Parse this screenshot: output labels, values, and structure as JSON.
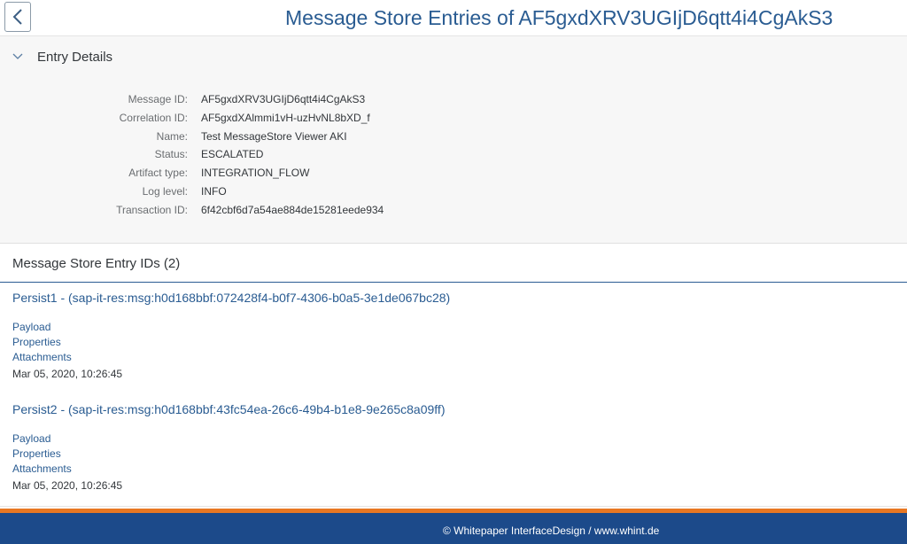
{
  "header": {
    "title": "Message Store Entries of AF5gxdXRV3UGIjD6qtt4i4CgAkS3",
    "back_icon": "chevron-left-icon"
  },
  "details": {
    "title": "Entry Details",
    "toggle_icon": "chevron-down-icon",
    "fields": [
      {
        "label": "Message ID:",
        "value": "AF5gxdXRV3UGIjD6qtt4i4CgAkS3"
      },
      {
        "label": "Correlation ID:",
        "value": "AF5gxdXAlmmi1vH-uzHvNL8bXD_f"
      },
      {
        "label": "Name:",
        "value": "Test MessageStore Viewer AKI"
      },
      {
        "label": "Status:",
        "value": "ESCALATED"
      },
      {
        "label": "Artifact type:",
        "value": "INTEGRATION_FLOW"
      },
      {
        "label": "Log level:",
        "value": "INFO"
      },
      {
        "label": "Transaction ID:",
        "value": "6f42cbf6d7a54ae884de15281eede934"
      }
    ]
  },
  "list": {
    "title": "Message Store Entry IDs (2)",
    "entries": [
      {
        "title": "Persist1 - (sap-it-res:msg:h0d168bbf:072428f4-b0f7-4306-b0a5-3e1de067bc28)",
        "payload": "Payload",
        "properties": "Properties",
        "attachments": "Attachments",
        "date": "Mar 05, 2020, 10:26:45"
      },
      {
        "title": "Persist2 - (sap-it-res:msg:h0d168bbf:43fc54ea-26c6-49b4-b1e8-9e265c8a09ff)",
        "payload": "Payload",
        "properties": "Properties",
        "attachments": "Attachments",
        "date": "Mar 05, 2020, 10:26:45"
      }
    ]
  },
  "footer": {
    "text": "© Whitepaper InterfaceDesign / www.whint.de"
  },
  "colors": {
    "accent": "#2a5c92",
    "footer_bg": "#1c4a8a",
    "footer_stripe": "#e87722"
  }
}
